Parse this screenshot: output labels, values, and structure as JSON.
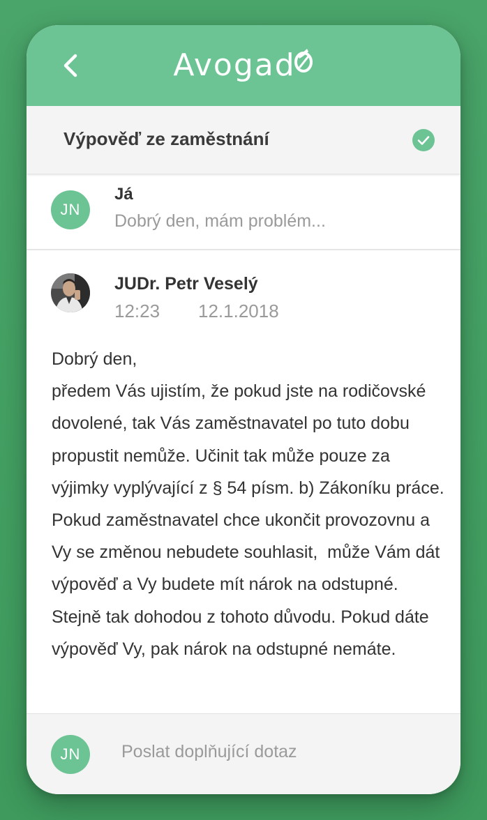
{
  "header": {
    "logo_text": "Avogad",
    "back_icon": "chevron-left-icon",
    "accent_color": "#6cc494"
  },
  "subject": {
    "title": "Výpověď ze zaměstnání",
    "status_icon": "check-circle-icon"
  },
  "messages": [
    {
      "author": "Já",
      "avatar_initials": "JN",
      "preview": "Dobrý den, mám problém..."
    },
    {
      "author": "JUDr. Petr Veselý",
      "avatar": "lawyer-photo",
      "time": "12:23",
      "date": "12.1.2018",
      "body_greeting": "Dobrý den,",
      "body_text": "předem Vás ujistím, že pokud jste na rodičovské dovolené, tak Vás zaměstnavatel po tuto dobu propustit nemůže. Učinit tak může pouze za výjimky vyplývající z § 54 písm. b) Zákoníku práce.  Pokud zaměstnavatel chce ukončit provozovnu a Vy se změnou nebudete souhlasit,  může Vám dát výpověď a Vy budete mít nárok na odstupné. Stejně tak dohodou z tohoto důvodu. Pokud dáte výpověď Vy, pak nárok na odstupné nemáte."
    }
  ],
  "footer": {
    "avatar_initials": "JN",
    "placeholder": "Poslat doplňující dotaz"
  }
}
